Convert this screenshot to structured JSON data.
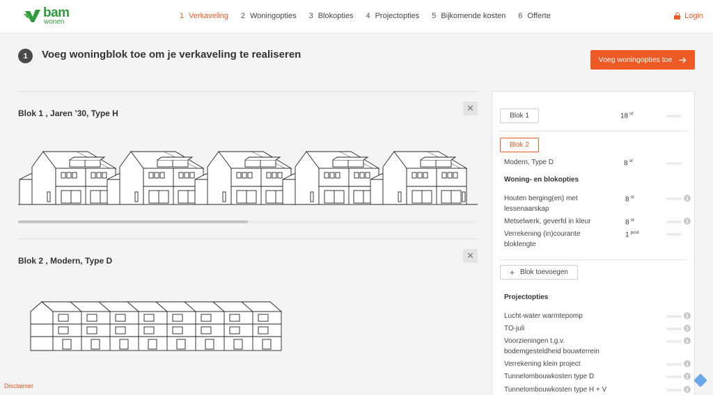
{
  "brand": {
    "name": "bam",
    "sub": "wonen",
    "color": "#2f9a3e"
  },
  "nav": {
    "steps": [
      {
        "num": "1",
        "label": "Verkaveling",
        "active": true
      },
      {
        "num": "2",
        "label": "Woningopties",
        "active": false
      },
      {
        "num": "3",
        "label": "Blokopties",
        "active": false
      },
      {
        "num": "4",
        "label": "Projectopties",
        "active": false
      },
      {
        "num": "5",
        "label": "Bijkomende kosten",
        "active": false
      },
      {
        "num": "6",
        "label": "Offerte",
        "active": false
      }
    ],
    "login_label": "Login",
    "login_icon": "lock-icon"
  },
  "heading": {
    "step_number": "1",
    "title": "Voeg woningblok toe om je verkaveling te realiseren",
    "cta_label": "Voeg woningopties toe",
    "cta_icon": "arrow-right-icon"
  },
  "blocks": [
    {
      "title": "Blok 1 , Jaren ’30, Type H",
      "scroll_position": 0.5
    },
    {
      "title": "Blok 2 , Modern, Type D"
    }
  ],
  "sidebar": {
    "block1": {
      "label": "Blok 1",
      "qty": "18",
      "unit": "st"
    },
    "block2": {
      "label": "Blok 2",
      "type_label": "Modern, Type D",
      "qty": "8",
      "unit": "st"
    },
    "woning_heading": "Woning- en blokopties",
    "woning_options": [
      {
        "line1": "Houten berging(en) met",
        "line2": "lessenaarskap",
        "qty": "8",
        "unit": "st"
      },
      {
        "line1": "Metselwerk, geverfd in kleur",
        "line2": "",
        "qty": "8",
        "unit": "st"
      },
      {
        "line1": "Verrekening (in)courante",
        "line2": "bloklengte",
        "qty": "1",
        "unit": "post"
      }
    ],
    "add_block_label": "Blok toevoegen",
    "add_icon": "plus-icon",
    "project_heading": "Projectopties",
    "project_options": [
      {
        "line1": "Lucht-water warmtepomp",
        "line2": ""
      },
      {
        "line1": "TO-juli",
        "line2": ""
      },
      {
        "line1": "Voorzieningen t.g.v.",
        "line2": "bodemgesteldheid bouwterrein"
      },
      {
        "line1": "Verrekening klein project",
        "line2": ""
      },
      {
        "line1": "Tunnelombouwkosten type D",
        "line2": ""
      },
      {
        "line1": "Tunnelombouwkosten type H + V",
        "line2": ""
      }
    ]
  },
  "footer": {
    "disclaimer": "Disclaimer"
  },
  "colors": {
    "accent": "#ee5a24",
    "dark": "#4a4a4a",
    "background": "#f4f4f4"
  }
}
